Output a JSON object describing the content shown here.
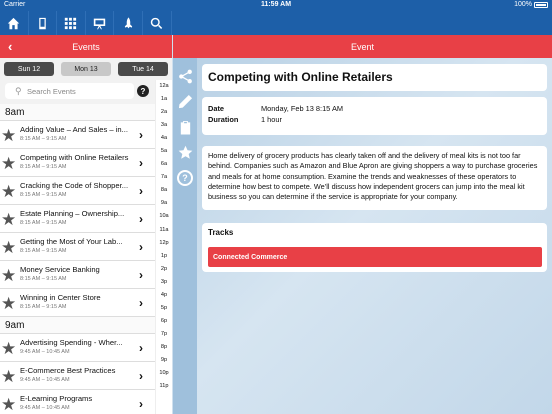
{
  "status": {
    "carrier": "Carrier",
    "time": "11:59 AM",
    "battery": "100%"
  },
  "nav": {
    "icons": [
      "home-icon",
      "phone-icon",
      "grid-icon",
      "presentation-icon",
      "rocket-icon",
      "search-icon"
    ]
  },
  "left_header": {
    "title": "Events"
  },
  "right_header": {
    "title": "Event"
  },
  "day_tabs": [
    "Sun 12",
    "Mon 13",
    "Tue 14"
  ],
  "search": {
    "placeholder": "Search Events"
  },
  "hours": [
    {
      "label": "8am",
      "events": [
        {
          "title": "Adding Value – And Sales – in...",
          "time": "8:15 AM – 9:15 AM"
        },
        {
          "title": "Competing with Online Retailers",
          "time": "8:15 AM – 9:15 AM"
        },
        {
          "title": "Cracking the Code of Shopper...",
          "time": "8:15 AM – 9:15 AM"
        },
        {
          "title": "Estate Planning – Ownership...",
          "time": "8:15 AM – 9:15 AM"
        },
        {
          "title": "Getting the Most of Your Lab...",
          "time": "8:15 AM – 9:15 AM"
        },
        {
          "title": "Money Service Banking",
          "time": "8:15 AM – 9:15 AM"
        },
        {
          "title": "Winning in Center Store",
          "time": "8:15 AM – 9:15 AM"
        }
      ]
    },
    {
      "label": "9am",
      "events": [
        {
          "title": "Advertising Spending - Wher...",
          "time": "9:45 AM – 10:45 AM"
        },
        {
          "title": "E-Commerce Best Practices",
          "time": "9:45 AM – 10:45 AM"
        },
        {
          "title": "E-Learning Programs",
          "time": "9:45 AM – 10:45 AM"
        }
      ]
    }
  ],
  "time_index": [
    "12a",
    "1a",
    "2a",
    "3a",
    "4a",
    "5a",
    "6a",
    "7a",
    "8a",
    "9a",
    "10a",
    "11a",
    "12p",
    "1p",
    "2p",
    "3p",
    "4p",
    "5p",
    "6p",
    "7p",
    "8p",
    "9p",
    "10p",
    "11p"
  ],
  "detail": {
    "title": "Competing with Online Retailers",
    "date_label": "Date",
    "date_value": "Monday, Feb 13 8:15 AM",
    "duration_label": "Duration",
    "duration_value": "1 hour",
    "description": "Home delivery of grocery products has clearly taken off and the delivery of meal kits is not too far behind. Companies such as Amazon and Blue Apron are giving shoppers a way to purchase groceries and meals for at home consumption. Examine the trends and weaknesses of these operators to determine how best to compete. We’ll discuss how independent grocers can jump into the meal kit business so you can determine if the service is appropriate for your company.",
    "tracks_label": "Tracks",
    "tracks": [
      "Connected Commerce"
    ]
  },
  "side_icons": [
    "share-icon",
    "pencil-icon",
    "clipboard-icon",
    "star-icon",
    "help-icon"
  ],
  "colors": {
    "brand_blue": "#1d5fa8",
    "accent_red": "#e84046"
  }
}
